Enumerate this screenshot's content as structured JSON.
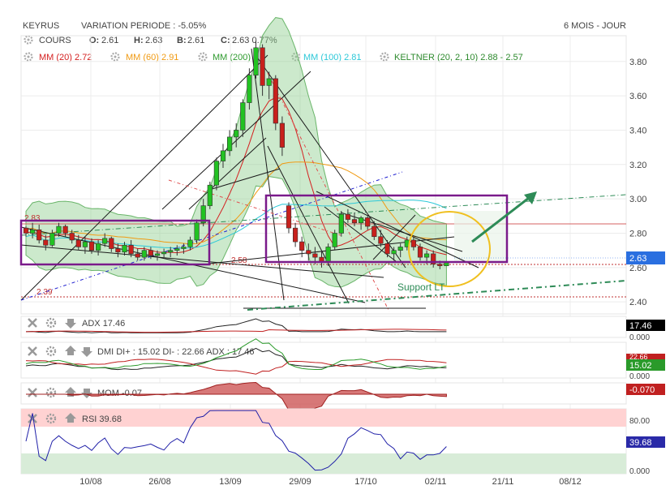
{
  "header": {
    "ticker": "KEYRUS",
    "variation": "VARIATION PERIODE : -5.05%",
    "period": "6 MOIS - JOUR"
  },
  "legend": {
    "cours": "COURS",
    "ohlc": [
      {
        "k": "O:",
        "v": "2.61"
      },
      {
        "k": "H:",
        "v": "2.63"
      },
      {
        "k": "B:",
        "v": "2.61"
      },
      {
        "k": "C:",
        "v": "2.63 0.77%"
      }
    ],
    "mas": [
      {
        "label": "MM (20)",
        "value": "2.72",
        "color": "#d42020"
      },
      {
        "label": "MM (60)",
        "value": "2.91",
        "color": "#f09a12"
      },
      {
        "label": "MM (200)",
        "value": "",
        "color": "#2e9a2e"
      },
      {
        "label": "MM (100)",
        "value": "2.81",
        "color": "#2cc8d8"
      },
      {
        "label": "KELTNER (20, 2, 10)",
        "value": "2.88 - 2.57",
        "color": "#2e8a2e"
      }
    ]
  },
  "colors": {
    "up": "#22c222",
    "down": "#c8201c",
    "keltner": "#8fcf8f",
    "mm20": "#d42020",
    "mm60": "#f09a12",
    "mm100": "#2cc8d8",
    "box": "#7a1a8a",
    "circle": "#f0c020",
    "arrow": "#2e8b57",
    "support": "#2e8b57",
    "priceTag": "#2a6fe0"
  },
  "annotations": {
    "support": "Support LT",
    "lvl283": "2.83",
    "lvl258": "2.58",
    "lvl239": "2.39"
  },
  "price_tag": "2.63",
  "x_labels": [
    "10/08",
    "26/08",
    "13/09",
    "29/09",
    "17/10",
    "02/11",
    "21/11",
    "08/12"
  ],
  "panels": {
    "adx": {
      "label": "ADX",
      "value": "17.46",
      "tag": "17.46",
      "tag2": "0.000"
    },
    "dmi": {
      "label": "DMI",
      "di_plus": "DI+ : 15.02",
      "di_minus": "DI- : 22.66",
      "adx": "ADX : 17.46",
      "tag_top": "22.66",
      "tag": "15.02",
      "tag2": "0.000"
    },
    "mom": {
      "label": "MOM",
      "value": "-0.07",
      "tag": "-0.070"
    },
    "rsi": {
      "label": "RSI",
      "value": "39.68",
      "tag": "39.68",
      "lvl80": "80.00",
      "lvl0": "0.000"
    }
  },
  "chart_data": {
    "type": "line",
    "title": "",
    "y_ticks": [
      2.4,
      2.6,
      2.8,
      3.0,
      3.2,
      3.4,
      3.6,
      3.8
    ],
    "ylim": [
      2.33,
      3.95
    ],
    "main_levels": [
      2.83,
      2.58,
      2.39
    ],
    "candles": [
      [
        0,
        2.83,
        2.84,
        2.78,
        2.8
      ],
      [
        1,
        2.8,
        2.86,
        2.77,
        2.82
      ],
      [
        2,
        2.82,
        2.85,
        2.74,
        2.76
      ],
      [
        3,
        2.76,
        2.79,
        2.7,
        2.73
      ],
      [
        4,
        2.73,
        2.82,
        2.72,
        2.8
      ],
      [
        5,
        2.8,
        2.86,
        2.78,
        2.84
      ],
      [
        6,
        2.84,
        2.85,
        2.78,
        2.8
      ],
      [
        7,
        2.8,
        2.82,
        2.74,
        2.76
      ],
      [
        8,
        2.76,
        2.79,
        2.7,
        2.72
      ],
      [
        9,
        2.72,
        2.78,
        2.68,
        2.75
      ],
      [
        10,
        2.75,
        2.77,
        2.68,
        2.7
      ],
      [
        11,
        2.7,
        2.76,
        2.67,
        2.74
      ],
      [
        12,
        2.74,
        2.8,
        2.72,
        2.77
      ],
      [
        13,
        2.77,
        2.78,
        2.69,
        2.71
      ],
      [
        14,
        2.71,
        2.74,
        2.66,
        2.69
      ],
      [
        15,
        2.69,
        2.75,
        2.67,
        2.73
      ],
      [
        16,
        2.73,
        2.76,
        2.66,
        2.68
      ],
      [
        17,
        2.68,
        2.71,
        2.64,
        2.66
      ],
      [
        18,
        2.66,
        2.72,
        2.64,
        2.7
      ],
      [
        19,
        2.7,
        2.72,
        2.65,
        2.67
      ],
      [
        20,
        2.67,
        2.7,
        2.64,
        2.68
      ],
      [
        21,
        2.68,
        2.71,
        2.66,
        2.69
      ],
      [
        22,
        2.69,
        2.72,
        2.66,
        2.7
      ],
      [
        23,
        2.7,
        2.73,
        2.67,
        2.71
      ],
      [
        24,
        2.71,
        2.74,
        2.68,
        2.72
      ],
      [
        25,
        2.72,
        2.78,
        2.7,
        2.76
      ],
      [
        26,
        2.76,
        2.88,
        2.74,
        2.86
      ],
      [
        27,
        2.86,
        3.0,
        2.84,
        2.96
      ],
      [
        28,
        2.96,
        3.1,
        2.94,
        3.08
      ],
      [
        29,
        3.08,
        3.24,
        3.05,
        3.22
      ],
      [
        30,
        3.22,
        3.32,
        3.18,
        3.28
      ],
      [
        31,
        3.28,
        3.4,
        3.25,
        3.36
      ],
      [
        32,
        3.36,
        3.44,
        3.3,
        3.4
      ],
      [
        33,
        3.4,
        3.58,
        3.36,
        3.56
      ],
      [
        34,
        3.56,
        3.76,
        3.52,
        3.72
      ],
      [
        35,
        3.72,
        3.92,
        3.7,
        3.88
      ],
      [
        36,
        3.88,
        3.9,
        3.6,
        3.66
      ],
      [
        37,
        3.66,
        3.74,
        3.58,
        3.7
      ],
      [
        38,
        3.7,
        3.72,
        3.4,
        3.44
      ],
      [
        39,
        3.44,
        3.48,
        3.25,
        3.3
      ],
      [
        40,
        2.96,
        2.98,
        2.8,
        2.83
      ],
      [
        41,
        2.83,
        2.86,
        2.72,
        2.75
      ],
      [
        42,
        2.75,
        2.78,
        2.66,
        2.7
      ],
      [
        43,
        2.7,
        2.74,
        2.64,
        2.68
      ],
      [
        44,
        2.68,
        2.72,
        2.62,
        2.66
      ],
      [
        45,
        2.66,
        2.7,
        2.6,
        2.63
      ],
      [
        46,
        2.63,
        2.74,
        2.61,
        2.72
      ],
      [
        47,
        2.72,
        2.82,
        2.7,
        2.8
      ],
      [
        48,
        2.8,
        2.93,
        2.78,
        2.91
      ],
      [
        49,
        2.91,
        2.94,
        2.86,
        2.88
      ],
      [
        50,
        2.88,
        2.92,
        2.84,
        2.86
      ],
      [
        51,
        2.86,
        2.9,
        2.82,
        2.89
      ],
      [
        52,
        2.89,
        2.9,
        2.82,
        2.84
      ],
      [
        53,
        2.84,
        2.87,
        2.76,
        2.78
      ],
      [
        54,
        2.78,
        2.82,
        2.72,
        2.74
      ],
      [
        55,
        2.74,
        2.76,
        2.66,
        2.68
      ],
      [
        56,
        2.68,
        2.72,
        2.64,
        2.7
      ],
      [
        57,
        2.7,
        2.74,
        2.66,
        2.72
      ],
      [
        58,
        2.72,
        2.78,
        2.7,
        2.76
      ],
      [
        59,
        2.76,
        2.78,
        2.7,
        2.72
      ],
      [
        60,
        2.72,
        2.74,
        2.64,
        2.66
      ],
      [
        61,
        2.66,
        2.7,
        2.62,
        2.68
      ],
      [
        62,
        2.68,
        2.7,
        2.6,
        2.62
      ],
      [
        63,
        2.62,
        2.64,
        2.59,
        2.61
      ],
      [
        64,
        2.61,
        2.63,
        2.61,
        2.63
      ]
    ],
    "rsi_levels": [
      80,
      0
    ],
    "x_labels": [
      "10/08",
      "26/08",
      "13/09",
      "29/09",
      "17/10",
      "02/11",
      "21/11",
      "08/12"
    ]
  }
}
